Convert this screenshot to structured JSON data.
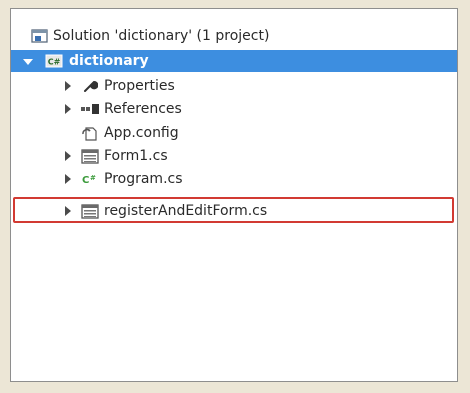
{
  "solution_explorer": {
    "solution_label": "Solution 'dictionary' (1 project)",
    "project_label": "dictionary",
    "items": [
      {
        "label": "Properties",
        "icon": "wrench-icon",
        "expandable": true
      },
      {
        "label": "References",
        "icon": "references-icon",
        "expandable": true
      },
      {
        "label": "App.config",
        "icon": "config-file-icon",
        "expandable": false
      },
      {
        "label": "Form1.cs",
        "icon": "form-icon",
        "expandable": true
      },
      {
        "label": "Program.cs",
        "icon": "csharp-file-icon",
        "expandable": true
      },
      {
        "label": "registerAndEditForm.cs",
        "icon": "form-icon",
        "expandable": true,
        "highlighted": true
      }
    ]
  },
  "colors": {
    "selection": "#3d8ee0",
    "highlight_border": "#d23a32"
  }
}
